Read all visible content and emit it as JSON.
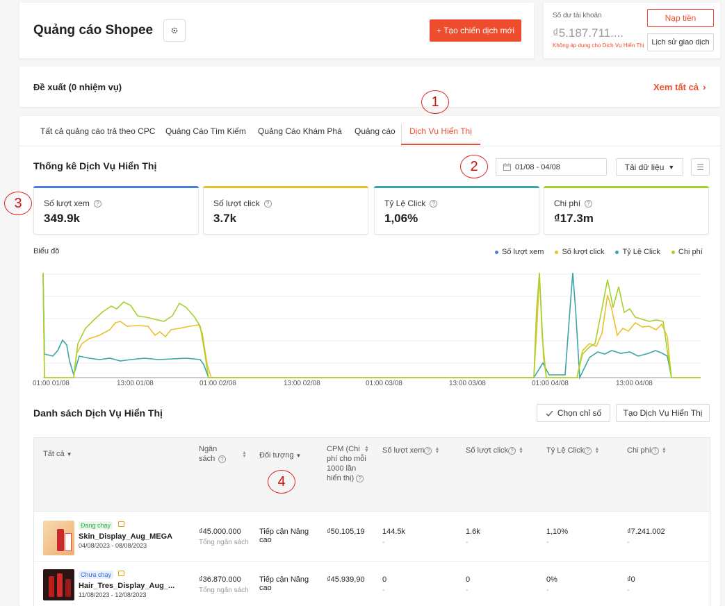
{
  "header": {
    "title": "Quảng cáo Shopee",
    "create_button": "+ Tạo chiến dịch mới"
  },
  "balance": {
    "label": "Số dư tài khoản",
    "amount": "₫5.187.711....",
    "note": "Không áp dụng cho Dịch Vụ Hiển Thị",
    "topup_button": "Nạp tiền",
    "history_button": "Lịch sử giao dịch"
  },
  "suggestions": {
    "title": "Đề xuất (0 nhiệm vụ)",
    "view_all": "Xem tất cả"
  },
  "annotations": {
    "m1": "1",
    "m2": "2",
    "m3": "3",
    "m4": "4"
  },
  "tabs": [
    {
      "label": "Tất cả quảng cáo trả theo CPC"
    },
    {
      "label": "Quảng Cáo Tìm Kiếm"
    },
    {
      "label": "Quảng Cáo Khám Phá"
    },
    {
      "label": "Quảng cáo"
    },
    {
      "label": "Dịch Vụ Hiển Thị",
      "active": true
    }
  ],
  "stats": {
    "title": "Thống kê Dịch Vụ Hiển Thị",
    "date_range": "01/08 - 04/08",
    "download_button": "Tải dữ liệu",
    "metrics": [
      {
        "label": "Số lượt xem",
        "value": "349.9k",
        "color": "#4a7ed9"
      },
      {
        "label": "Số lượt click",
        "value": "3.7k",
        "color": "#e9c12b"
      },
      {
        "label": "Tỷ Lệ Click",
        "value": "1,06%",
        "color": "#3aa5a3"
      },
      {
        "label": "Chi phí",
        "value": "₫17.3m",
        "color": "#a5d12d"
      }
    ]
  },
  "chart": {
    "label": "Biểu đồ",
    "legend": [
      {
        "name": "Số lượt xem",
        "color": "#4a7ed9"
      },
      {
        "name": "Số lượt click",
        "color": "#e9c12b"
      },
      {
        "name": "Tỷ Lệ Click",
        "color": "#3aa5a3"
      },
      {
        "name": "Chi phí",
        "color": "#a5d12d"
      }
    ],
    "ticks": [
      "01:00 01/08",
      "13:00 01/08",
      "01:00 02/08",
      "13:00 02/08",
      "01:00 03/08",
      "13:00 03/08",
      "01:00 04/08",
      "13:00 04/08"
    ]
  },
  "list": {
    "title": "Danh sách Dịch Vụ Hiển Thị",
    "choose_metrics_button": "Chọn chỉ số",
    "create_button": "Tạo Dịch Vụ Hiển Thị",
    "columns": {
      "all": "Tất cả",
      "budget": "Ngân sách",
      "target": "Đối tượng",
      "cpm": "CPM (Chi phí cho mỗi 1000 lần hiển thị)",
      "views": "Số lượt xem",
      "clicks": "Số lượt click",
      "ctr": "Tỷ Lệ Click",
      "cost": "Chi phí"
    },
    "rows": [
      {
        "status": "Đang chạy",
        "name": "Skin_Display_Aug_MEGA",
        "dates": "04/08/2023 - 08/08/2023",
        "budget": "₫45.000.000",
        "budget_note": "Tổng ngân sách",
        "target": "Tiếp cận Nâng cao",
        "cpm": "₫50.105,19",
        "views": "144.5k",
        "clicks": "1.6k",
        "ctr": "1,10%",
        "cost": "₫7.241.002",
        "dash": "-"
      },
      {
        "status": "Chưa chạy",
        "name": "Hair_Tres_Display_Aug_...",
        "dates": "11/08/2023 - 12/08/2023",
        "budget": "₫36.870.000",
        "budget_note": "Tổng ngân sách",
        "target": "Tiếp cận Nâng cao",
        "cpm": "₫45.939,90",
        "views": "0",
        "clicks": "0",
        "ctr": "0%",
        "cost": "₫0",
        "dash": "-"
      }
    ]
  }
}
